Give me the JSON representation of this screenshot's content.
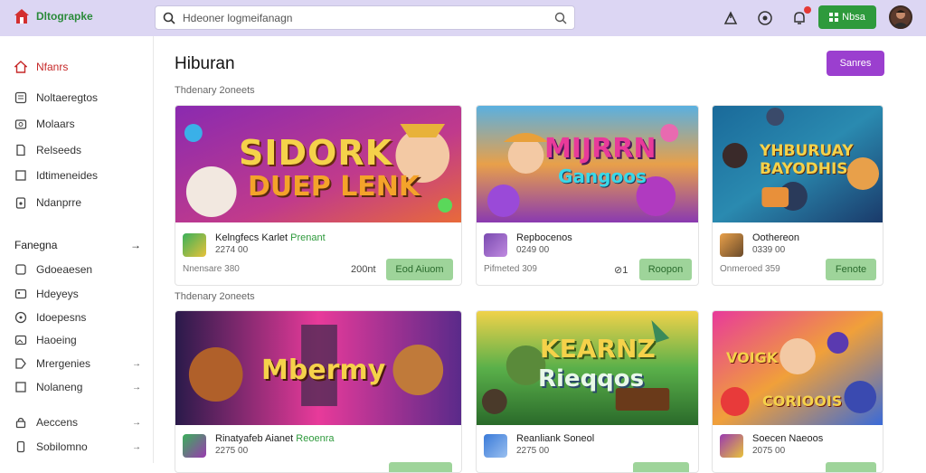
{
  "header": {
    "logo_text": "Dltograpke",
    "search_placeholder": "Hdeoner logmeifanagn",
    "cta_label": "Nbsa"
  },
  "sidebar": {
    "items": [
      {
        "label": "Nfanrs"
      },
      {
        "label": "Noltaeregtos"
      },
      {
        "label": "Molaars"
      },
      {
        "label": "Relseeds"
      },
      {
        "label": "Idtimeneides"
      },
      {
        "label": "Ndanprre"
      }
    ],
    "section_title": "Fanegna",
    "section_arrow": "→",
    "section_items": [
      {
        "label": "Gdoeaesen",
        "arrow": ""
      },
      {
        "label": "Hdeyeys",
        "arrow": ""
      },
      {
        "label": "Idoepesns",
        "arrow": ""
      },
      {
        "label": "Haoeing",
        "arrow": ""
      },
      {
        "label": "Mrergenies",
        "arrow": "→"
      },
      {
        "label": "Nolaneng",
        "arrow": "→"
      },
      {
        "label": "Aeccens",
        "arrow": "→"
      },
      {
        "label": "Sobilomno",
        "arrow": "→"
      }
    ]
  },
  "main": {
    "title": "Hiburan",
    "cta_label": "Sanres",
    "row_labels": [
      "Thdenary 2oneets",
      "Thdenary 2oneets"
    ],
    "cards": [
      {
        "banner_text": [
          "SIDORK",
          "DUEP LENK"
        ],
        "title": "Kelngfecs Karlet ",
        "title_hl": "Prenant",
        "sub": "2274 00",
        "meta": "Nnensare 380",
        "count": "200nt",
        "button": "Eod Aiuom"
      },
      {
        "banner_text": [
          "MIJRRN",
          "Gangoos"
        ],
        "title": "Repbocenos",
        "title_hl": "",
        "sub": "0249 00",
        "meta": "Pifmeted 309",
        "count": "⊘1",
        "button": "Roopon"
      },
      {
        "banner_text": [
          "YHBURUAY",
          "BAYODHIS"
        ],
        "title": "Oothereon",
        "title_hl": "",
        "sub": "0339 00",
        "meta": "Onmeroed 359",
        "count": "",
        "button": "Fenote"
      },
      {
        "banner_text": [
          "Mbermy"
        ],
        "title": "Rinatyafeb Aianet ",
        "title_hl": "Reoenra",
        "sub": "2275 00",
        "meta": "",
        "count": "",
        "button": ""
      },
      {
        "banner_text": [
          "KEARNZ",
          "Rieqqos"
        ],
        "title": "Reanliank Soneol",
        "title_hl": "",
        "sub": "2275 00",
        "meta": "",
        "count": "",
        "button": ""
      },
      {
        "banner_text": [
          "VOIGK",
          "CORIOOIS"
        ],
        "title": "Soecen Naeoos",
        "title_hl": "",
        "sub": "2075 00",
        "meta": "",
        "count": "",
        "button": ""
      }
    ]
  }
}
